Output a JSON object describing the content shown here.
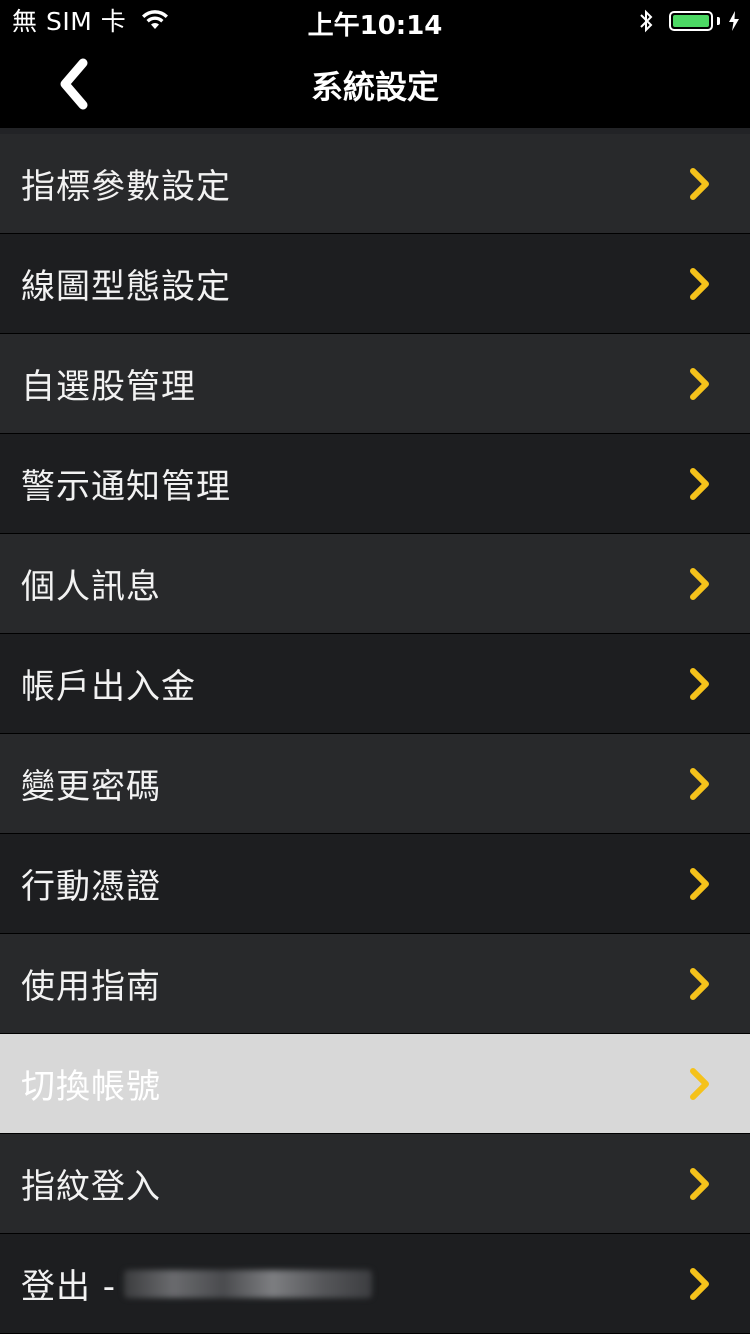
{
  "status_bar": {
    "carrier": "無 SIM 卡",
    "time": "上午10:14",
    "icons": [
      "wifi-icon",
      "bluetooth-icon",
      "battery-icon",
      "charging-bolt-icon"
    ],
    "battery_color": "#4cd964"
  },
  "nav": {
    "title": "系統設定",
    "back_icon": "chevron-left-icon"
  },
  "colors": {
    "chevron": "#f5c21b",
    "row_odd": "#28292b",
    "row_even": "#1d1e20",
    "row_selected": "#d8d8d8"
  },
  "menu": {
    "items": [
      {
        "label": "指標參數設定"
      },
      {
        "label": "線圖型態設定"
      },
      {
        "label": "自選股管理"
      },
      {
        "label": "警示通知管理"
      },
      {
        "label": "個人訊息"
      },
      {
        "label": "帳戶出入金"
      },
      {
        "label": "變更密碼"
      },
      {
        "label": "行動憑證"
      },
      {
        "label": "使用指南"
      },
      {
        "label": "切換帳號",
        "selected": true
      },
      {
        "label": "指紋登入"
      },
      {
        "label": "登出 -"
      }
    ]
  }
}
